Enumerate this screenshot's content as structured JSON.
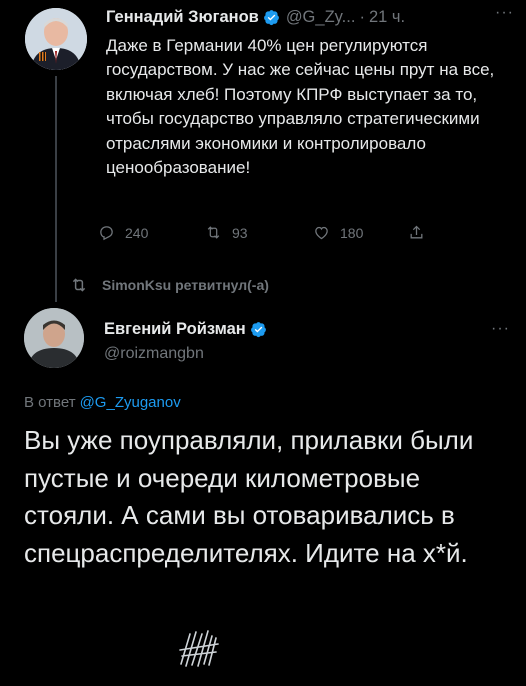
{
  "tweet1": {
    "author_name": "Геннадий Зюганов",
    "handle": "@G_Zy...",
    "separator": "·",
    "time": "21 ч.",
    "more": "···",
    "text": "Даже в Германии 40% цен регулируются государством. У нас же сейчас цены прут на все, включая хлеб! Поэтому КПРФ выступает за то, чтобы государство управляло стратегическими отраслями экономики и контролировало ценообразование!",
    "replies": "240",
    "retweets": "93",
    "likes": "180"
  },
  "retweet_notice": "SimonKsu ретвитнул(-а)",
  "tweet2": {
    "author_name": "Евгений Ройзман",
    "handle": "@roizmangbn",
    "more": "···",
    "reply_prefix": "В ответ",
    "reply_to": "@G_Zyuganov",
    "text": "Вы уже поуправляли, прилавки были пустые и очереди километровые стояли. А сами вы отоваривались в спецраспределителях. Идите на х*й."
  },
  "colors": {
    "background": "#000000",
    "text": "#e7e9ea",
    "muted": "#71767b",
    "link": "#1d9bf0",
    "verified": "#1d9bf0"
  },
  "icons": [
    "reply-icon",
    "retweet-icon",
    "like-icon",
    "share-icon",
    "verified-badge-icon",
    "censor-scribble"
  ]
}
